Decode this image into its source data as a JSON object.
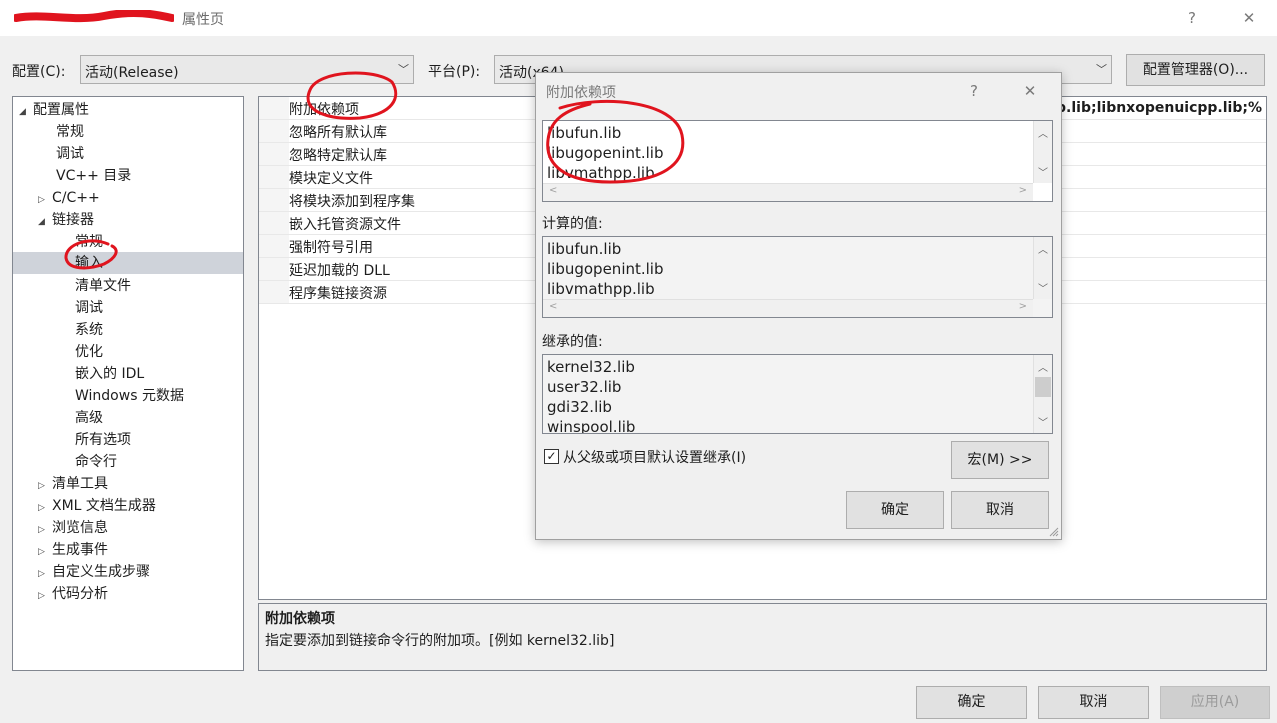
{
  "window": {
    "title": "属性页",
    "help_glyph": "?",
    "close_glyph": "✕"
  },
  "config": {
    "config_label": "配置(C):",
    "config_value": "活动(Release)",
    "platform_label": "平台(P):",
    "platform_value": "活动(x64)",
    "manager_button": "配置管理器(O)..."
  },
  "tree": {
    "items": [
      {
        "label": "配置属性",
        "twisty": "◢"
      },
      {
        "label": "常规",
        "twisty": ""
      },
      {
        "label": "调试",
        "twisty": ""
      },
      {
        "label": "VC++ 目录",
        "twisty": ""
      },
      {
        "label": "C/C++",
        "twisty": "▷"
      },
      {
        "label": "链接器",
        "twisty": "◢"
      },
      {
        "label": "常规",
        "twisty": ""
      },
      {
        "label": "输入",
        "twisty": ""
      },
      {
        "label": "清单文件",
        "twisty": ""
      },
      {
        "label": "调试",
        "twisty": ""
      },
      {
        "label": "系统",
        "twisty": ""
      },
      {
        "label": "优化",
        "twisty": ""
      },
      {
        "label": "嵌入的 IDL",
        "twisty": ""
      },
      {
        "label": "Windows 元数据",
        "twisty": ""
      },
      {
        "label": "高级",
        "twisty": ""
      },
      {
        "label": "所有选项",
        "twisty": ""
      },
      {
        "label": "命令行",
        "twisty": ""
      },
      {
        "label": "清单工具",
        "twisty": "▷"
      },
      {
        "label": "XML 文档生成器",
        "twisty": "▷"
      },
      {
        "label": "浏览信息",
        "twisty": "▷"
      },
      {
        "label": "生成事件",
        "twisty": "▷"
      },
      {
        "label": "自定义生成步骤",
        "twisty": "▷"
      },
      {
        "label": "代码分析",
        "twisty": "▷"
      }
    ]
  },
  "grid": {
    "rows": [
      {
        "name": "附加依赖项",
        "value": "cpp.lib;libnxopenuicpp.lib;%"
      },
      {
        "name": "忽略所有默认库",
        "value": ""
      },
      {
        "name": "忽略特定默认库",
        "value": ""
      },
      {
        "name": "模块定义文件",
        "value": ""
      },
      {
        "name": "将模块添加到程序集",
        "value": ""
      },
      {
        "name": "嵌入托管资源文件",
        "value": ""
      },
      {
        "name": "强制符号引用",
        "value": ""
      },
      {
        "name": "延迟加载的 DLL",
        "value": ""
      },
      {
        "name": "程序集链接资源",
        "value": ""
      }
    ]
  },
  "description": {
    "title": "附加依赖项",
    "text": "指定要添加到链接命令行的附加项。[例如 kernel32.lib]"
  },
  "dialog": {
    "title": "附加依赖项",
    "edit_lines": [
      "libufun.lib",
      "libugopenint.lib",
      "libvmathpp.lib"
    ],
    "computed_label": "计算的值:",
    "computed_lines": [
      "libufun.lib",
      "libugopenint.lib",
      "libvmathpp.lib"
    ],
    "inherited_label": "继承的值:",
    "inherited_lines": [
      "kernel32.lib",
      "user32.lib",
      "gdi32.lib",
      "winspool.lib"
    ],
    "inherit_checkbox": "从父级或项目默认设置继承(I)",
    "inherit_checked": true,
    "macro_button": "宏(M) >>",
    "ok_button": "确定",
    "cancel_button": "取消"
  },
  "footer": {
    "ok": "确定",
    "cancel": "取消",
    "apply": "应用(A)"
  },
  "colors": {
    "annotation_red": "#e0141e",
    "selection": "#cfd3da"
  }
}
